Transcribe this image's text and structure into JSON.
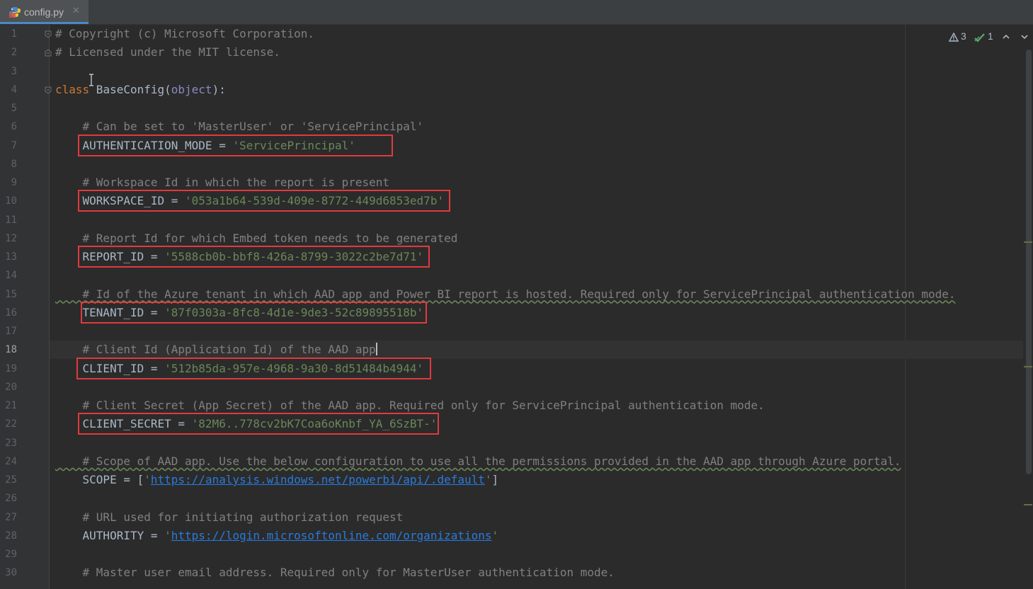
{
  "tab": {
    "filename": "config.py",
    "icon": "python-file-icon",
    "close_glyph": "✕"
  },
  "inspection": {
    "warnings": "3",
    "weak_warnings": "1"
  },
  "colors": {
    "comment": "#808080",
    "keyword": "#cc7832",
    "builtin": "#8888c6",
    "string": "#6a8759",
    "link": "#287bde",
    "highlight_box": "#e03a3e"
  },
  "current_line": 18,
  "lines": [
    {
      "n": "1",
      "text": "# Copyright (c) Microsoft Corporation."
    },
    {
      "n": "2",
      "text": "# Licensed under the MIT license."
    },
    {
      "n": "3",
      "text": ""
    },
    {
      "n": "4",
      "kw": "class",
      "name": " BaseConfig(",
      "builtin": "object",
      "tail": "):"
    },
    {
      "n": "5",
      "text": ""
    },
    {
      "n": "6",
      "text": "    # Can be set to 'MasterUser' or 'ServicePrincipal'"
    },
    {
      "n": "7",
      "name": "    AUTHENTICATION_MODE = ",
      "value": "'ServicePrincipal'"
    },
    {
      "n": "8",
      "text": ""
    },
    {
      "n": "9",
      "text": "    # Workspace Id in which the report is present"
    },
    {
      "n": "10",
      "name": "    WORKSPACE_ID = ",
      "value": "'053a1b64-539d-409e-8772-449d6853ed7b'"
    },
    {
      "n": "11",
      "text": ""
    },
    {
      "n": "12",
      "text": "    # Report Id for which Embed token needs to be generated"
    },
    {
      "n": "13",
      "name": "    REPORT_ID = ",
      "value": "'5588cb0b-bbf8-426a-8799-3022c2be7d71'"
    },
    {
      "n": "14",
      "text": ""
    },
    {
      "n": "15",
      "text": "    # Id of the Azure tenant in which AAD app and Power BI report is hosted. Required only for ServicePrincipal authentication mode."
    },
    {
      "n": "16",
      "name": "    TENANT_ID = ",
      "value": "'87f0303a-8fc8-4d1e-9de3-52c89895518b'"
    },
    {
      "n": "17",
      "text": ""
    },
    {
      "n": "18",
      "text": "    # Client Id (Application Id) of the AAD app"
    },
    {
      "n": "19",
      "name": "    CLIENT_ID = ",
      "value": "'512b85da-957e-4968-9a30-8d51484b4944'"
    },
    {
      "n": "20",
      "text": ""
    },
    {
      "n": "21",
      "text": "    # Client Secret (App Secret) of the AAD app. Required only for ServicePrincipal authentication mode."
    },
    {
      "n": "22",
      "name": "    CLIENT_SECRET = ",
      "value": "'82M6..778cv2bK7Coa6oKnbf_YA_6SzBT-'"
    },
    {
      "n": "23",
      "text": ""
    },
    {
      "n": "24",
      "text": "    # Scope of AAD app. Use the below configuration to use all the permissions provided in the AAD app through Azure portal."
    },
    {
      "n": "25",
      "name": "    SCOPE = [",
      "q1": "'",
      "url": "https://analysis.windows.net/powerbi/api/.default",
      "q2": "'",
      "tail": "]"
    },
    {
      "n": "26",
      "text": ""
    },
    {
      "n": "27",
      "text": "    # URL used for initiating authorization request"
    },
    {
      "n": "28",
      "name": "    AUTHORITY = ",
      "q1": "'",
      "url": "https://login.microsoftonline.com/organizations",
      "q2": "'"
    },
    {
      "n": "29",
      "text": ""
    },
    {
      "n": "30",
      "text": "    # Master user email address. Required only for MasterUser authentication mode."
    }
  ]
}
